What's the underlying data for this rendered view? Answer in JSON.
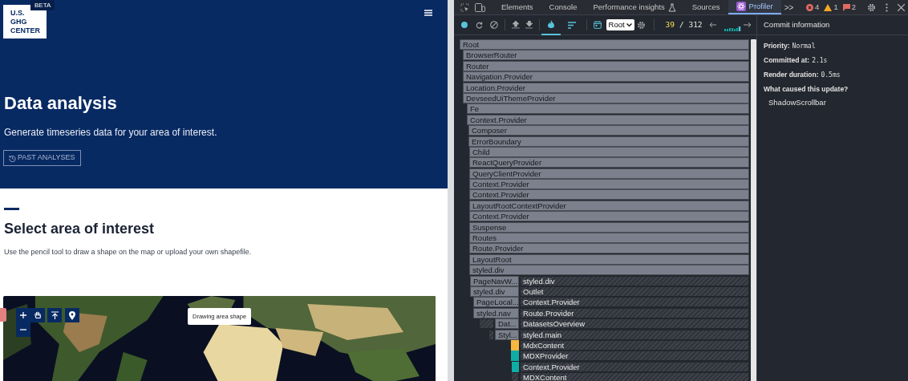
{
  "site": {
    "logo": {
      "lines": [
        "U.S.",
        "GHG",
        "CENTER"
      ],
      "badge": "BETA"
    },
    "hero": {
      "title": "Data analysis",
      "description": "Generate timeseries data for your area of interest.",
      "button": "PAST ANALYSES"
    },
    "section": {
      "title": "Select area of interest",
      "description": "Use the pencil tool to draw a shape on the map or upload your own shapefile."
    },
    "map": {
      "kind": "picture",
      "tooltip": "Drawing area shape"
    }
  },
  "devtools": {
    "tabs": [
      {
        "label": "Elements",
        "selected": false
      },
      {
        "label": "Console",
        "selected": false
      },
      {
        "label": "Performance insights",
        "selected": false
      },
      {
        "label": "Sources",
        "selected": false
      },
      {
        "label": "Profiler",
        "selected": true
      }
    ],
    "more": ">>",
    "errors": "4",
    "warnings": "1",
    "messages": "2",
    "profiler": {
      "views": [
        {
          "selected": true
        },
        {
          "selected": false
        }
      ],
      "root_select": "Root",
      "commit_index": "39",
      "commit_total": "/ 312"
    },
    "flame_rows": [
      {
        "segments": [
          {
            "label": "Root",
            "kind": "rendered"
          }
        ]
      },
      {
        "segments": [
          {
            "label": "BrowserRouter",
            "kind": "rendered"
          }
        ]
      },
      {
        "segments": [
          {
            "label": "Router",
            "kind": "rendered"
          }
        ]
      },
      {
        "segments": [
          {
            "label": "Navigation.Provider",
            "kind": "rendered"
          }
        ]
      },
      {
        "segments": [
          {
            "label": "Location.Provider",
            "kind": "rendered"
          }
        ]
      },
      {
        "segments": [
          {
            "label": "DevseedUiThemeProvider",
            "kind": "rendered"
          }
        ]
      },
      {
        "segments": [
          {
            "label": "Fe",
            "kind": "rendered"
          }
        ]
      },
      {
        "segments": [
          {
            "label": "Context.Provider",
            "kind": "rendered"
          }
        ]
      },
      {
        "segments": [
          {
            "label": "Composer",
            "kind": "rendered"
          }
        ]
      },
      {
        "segments": [
          {
            "label": "ErrorBoundary",
            "kind": "rendered"
          }
        ]
      },
      {
        "segments": [
          {
            "label": "Child",
            "kind": "rendered"
          }
        ]
      },
      {
        "segments": [
          {
            "label": "ReactQueryProvider",
            "kind": "rendered"
          }
        ]
      },
      {
        "segments": [
          {
            "label": "QueryClientProvider",
            "kind": "rendered"
          }
        ]
      },
      {
        "segments": [
          {
            "label": "Context.Provider",
            "kind": "rendered"
          }
        ]
      },
      {
        "segments": [
          {
            "label": "Context.Provider",
            "kind": "rendered"
          }
        ]
      },
      {
        "segments": [
          {
            "label": "LayoutRootContextProvider",
            "kind": "rendered"
          }
        ]
      },
      {
        "segments": [
          {
            "label": "Context.Provider",
            "kind": "rendered"
          }
        ]
      },
      {
        "segments": [
          {
            "label": "Suspense",
            "kind": "rendered"
          }
        ]
      },
      {
        "segments": [
          {
            "label": "Routes",
            "kind": "rendered"
          }
        ]
      },
      {
        "segments": [
          {
            "label": "Route.Provider",
            "kind": "rendered"
          }
        ]
      },
      {
        "segments": [
          {
            "label": "LayoutRoot",
            "kind": "rendered"
          }
        ]
      },
      {
        "segments": [
          {
            "label": "styled.div",
            "kind": "rendered"
          }
        ]
      },
      {
        "segments": [
          {
            "label": "PageNavW...",
            "kind": "rendered"
          },
          {
            "label": "styled.div",
            "kind": "unrendered"
          }
        ]
      },
      {
        "segments": [
          {
            "label": "styled.div",
            "kind": "rendered"
          },
          {
            "label": "Outlet",
            "kind": "unrendered"
          }
        ]
      },
      {
        "segments": [
          {
            "label": "PageLocal...",
            "kind": "rendered"
          },
          {
            "label": "Context.Provider",
            "kind": "unrendered"
          }
        ]
      },
      {
        "segments": [
          {
            "label": "styled.nav",
            "kind": "rendered"
          },
          {
            "label": "Route.Provider",
            "kind": "unrendered"
          }
        ]
      },
      {
        "segments": [
          {
            "kind": "unrendered"
          },
          {
            "label": "Dat...",
            "kind": "rendered"
          },
          {
            "label": "DatasetsOverview",
            "kind": "unrendered"
          }
        ]
      },
      {
        "segments": [
          {
            "kind": "unrendered"
          },
          {
            "label": "Styl...",
            "kind": "rendered"
          },
          {
            "label": "styled.main",
            "kind": "unrendered"
          }
        ]
      },
      {
        "segments": [
          {
            "kind": "slow"
          },
          {
            "label": "MdxContent",
            "kind": "unrendered"
          }
        ]
      },
      {
        "segments": [
          {
            "kind": "fast"
          },
          {
            "label": "MDXProvider",
            "kind": "unrendered"
          }
        ]
      },
      {
        "segments": [
          {
            "kind": "fast"
          },
          {
            "label": "Context.Provider",
            "kind": "unrendered"
          }
        ]
      },
      {
        "segments": [
          {
            "kind": "unrendered"
          },
          {
            "label": "MDXContent",
            "kind": "unrendered"
          }
        ]
      }
    ],
    "commit_info": {
      "title": "Commit information",
      "fields": [
        {
          "label": "Priority:",
          "value": "Normal"
        },
        {
          "label": "Committed at:",
          "value": "2.1s"
        },
        {
          "label": "Render duration:",
          "value": "0.5ms"
        }
      ],
      "cause_title": "What caused this update?",
      "causes": [
        "ShadowScrollbar"
      ]
    }
  }
}
